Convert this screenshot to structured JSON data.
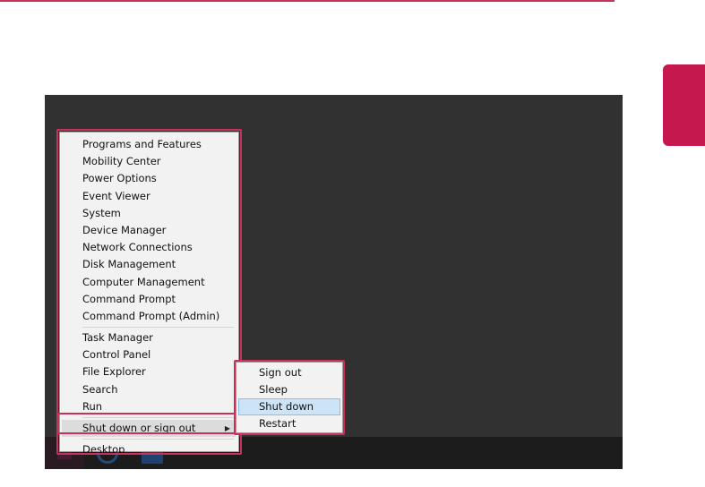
{
  "menu": {
    "groups": [
      [
        "Programs and Features",
        "Mobility Center",
        "Power Options",
        "Event Viewer",
        "System",
        "Device Manager",
        "Network Connections",
        "Disk Management",
        "Computer Management",
        "Command Prompt",
        "Command Prompt (Admin)"
      ],
      [
        "Task Manager",
        "Control Panel",
        "File Explorer",
        "Search",
        "Run"
      ]
    ],
    "shutdown_label": "Shut down or sign out",
    "desktop_label": "Desktop"
  },
  "submenu": {
    "items": [
      "Sign out",
      "Sleep",
      "Shut down",
      "Restart"
    ],
    "hovered_index": 2
  },
  "colors": {
    "accent": "#c9305a",
    "desktop": "#313131",
    "menu_bg": "#f2f2f2",
    "hover_bg": "#cde4f7"
  }
}
